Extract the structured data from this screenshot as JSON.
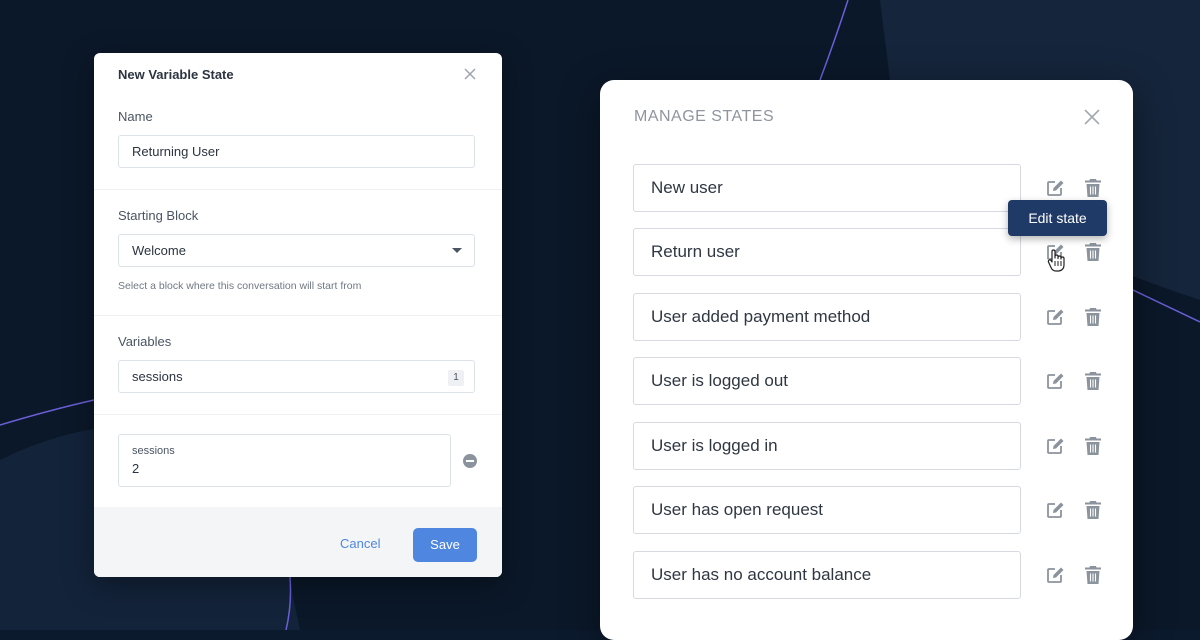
{
  "new_variable_state": {
    "title": "New Variable State",
    "name_label": "Name",
    "name_value": "Returning User",
    "starting_block_label": "Starting Block",
    "starting_block_value": "Welcome",
    "starting_block_helper": "Select a block where this conversation will start from",
    "variables_label": "Variables",
    "variables_value": "sessions",
    "variables_count": "1",
    "variable_entry": {
      "name": "sessions",
      "value": "2"
    },
    "cancel_label": "Cancel",
    "save_label": "Save"
  },
  "manage_states": {
    "title": "MANAGE STATES",
    "states": [
      "New user",
      "Return user",
      "User added payment method",
      "User is logged out",
      "User is logged in",
      "User has open request",
      "User has no account balance"
    ],
    "tooltip": "Edit state"
  },
  "colors": {
    "background": "#0c1a2e",
    "accent": "#4f86e0",
    "tooltip": "#1f3a66",
    "icon": "#8b939d"
  },
  "icons": [
    "close-icon",
    "dropdown-caret-icon",
    "remove-circle-icon",
    "edit-icon",
    "trash-icon",
    "hand-pointer-icon"
  ]
}
